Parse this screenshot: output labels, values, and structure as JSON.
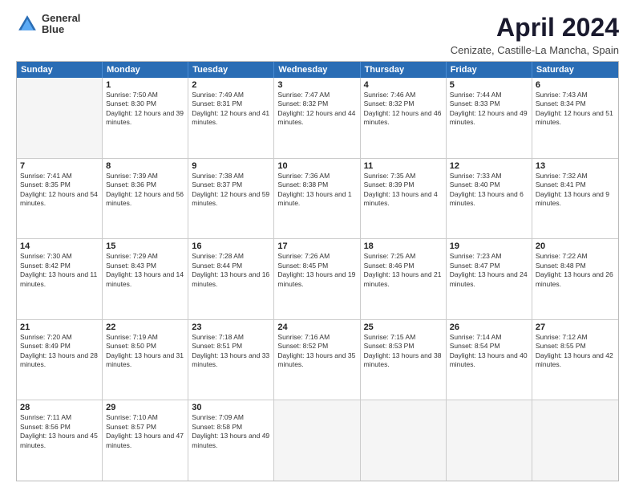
{
  "header": {
    "logo_line1": "General",
    "logo_line2": "Blue",
    "title": "April 2024",
    "subtitle": "Cenizate, Castille-La Mancha, Spain"
  },
  "weekdays": [
    "Sunday",
    "Monday",
    "Tuesday",
    "Wednesday",
    "Thursday",
    "Friday",
    "Saturday"
  ],
  "weeks": [
    [
      {
        "day": "",
        "sunrise": "",
        "sunset": "",
        "daylight": ""
      },
      {
        "day": "1",
        "sunrise": "Sunrise: 7:50 AM",
        "sunset": "Sunset: 8:30 PM",
        "daylight": "Daylight: 12 hours and 39 minutes."
      },
      {
        "day": "2",
        "sunrise": "Sunrise: 7:49 AM",
        "sunset": "Sunset: 8:31 PM",
        "daylight": "Daylight: 12 hours and 41 minutes."
      },
      {
        "day": "3",
        "sunrise": "Sunrise: 7:47 AM",
        "sunset": "Sunset: 8:32 PM",
        "daylight": "Daylight: 12 hours and 44 minutes."
      },
      {
        "day": "4",
        "sunrise": "Sunrise: 7:46 AM",
        "sunset": "Sunset: 8:32 PM",
        "daylight": "Daylight: 12 hours and 46 minutes."
      },
      {
        "day": "5",
        "sunrise": "Sunrise: 7:44 AM",
        "sunset": "Sunset: 8:33 PM",
        "daylight": "Daylight: 12 hours and 49 minutes."
      },
      {
        "day": "6",
        "sunrise": "Sunrise: 7:43 AM",
        "sunset": "Sunset: 8:34 PM",
        "daylight": "Daylight: 12 hours and 51 minutes."
      }
    ],
    [
      {
        "day": "7",
        "sunrise": "Sunrise: 7:41 AM",
        "sunset": "Sunset: 8:35 PM",
        "daylight": "Daylight: 12 hours and 54 minutes."
      },
      {
        "day": "8",
        "sunrise": "Sunrise: 7:39 AM",
        "sunset": "Sunset: 8:36 PM",
        "daylight": "Daylight: 12 hours and 56 minutes."
      },
      {
        "day": "9",
        "sunrise": "Sunrise: 7:38 AM",
        "sunset": "Sunset: 8:37 PM",
        "daylight": "Daylight: 12 hours and 59 minutes."
      },
      {
        "day": "10",
        "sunrise": "Sunrise: 7:36 AM",
        "sunset": "Sunset: 8:38 PM",
        "daylight": "Daylight: 13 hours and 1 minute."
      },
      {
        "day": "11",
        "sunrise": "Sunrise: 7:35 AM",
        "sunset": "Sunset: 8:39 PM",
        "daylight": "Daylight: 13 hours and 4 minutes."
      },
      {
        "day": "12",
        "sunrise": "Sunrise: 7:33 AM",
        "sunset": "Sunset: 8:40 PM",
        "daylight": "Daylight: 13 hours and 6 minutes."
      },
      {
        "day": "13",
        "sunrise": "Sunrise: 7:32 AM",
        "sunset": "Sunset: 8:41 PM",
        "daylight": "Daylight: 13 hours and 9 minutes."
      }
    ],
    [
      {
        "day": "14",
        "sunrise": "Sunrise: 7:30 AM",
        "sunset": "Sunset: 8:42 PM",
        "daylight": "Daylight: 13 hours and 11 minutes."
      },
      {
        "day": "15",
        "sunrise": "Sunrise: 7:29 AM",
        "sunset": "Sunset: 8:43 PM",
        "daylight": "Daylight: 13 hours and 14 minutes."
      },
      {
        "day": "16",
        "sunrise": "Sunrise: 7:28 AM",
        "sunset": "Sunset: 8:44 PM",
        "daylight": "Daylight: 13 hours and 16 minutes."
      },
      {
        "day": "17",
        "sunrise": "Sunrise: 7:26 AM",
        "sunset": "Sunset: 8:45 PM",
        "daylight": "Daylight: 13 hours and 19 minutes."
      },
      {
        "day": "18",
        "sunrise": "Sunrise: 7:25 AM",
        "sunset": "Sunset: 8:46 PM",
        "daylight": "Daylight: 13 hours and 21 minutes."
      },
      {
        "day": "19",
        "sunrise": "Sunrise: 7:23 AM",
        "sunset": "Sunset: 8:47 PM",
        "daylight": "Daylight: 13 hours and 24 minutes."
      },
      {
        "day": "20",
        "sunrise": "Sunrise: 7:22 AM",
        "sunset": "Sunset: 8:48 PM",
        "daylight": "Daylight: 13 hours and 26 minutes."
      }
    ],
    [
      {
        "day": "21",
        "sunrise": "Sunrise: 7:20 AM",
        "sunset": "Sunset: 8:49 PM",
        "daylight": "Daylight: 13 hours and 28 minutes."
      },
      {
        "day": "22",
        "sunrise": "Sunrise: 7:19 AM",
        "sunset": "Sunset: 8:50 PM",
        "daylight": "Daylight: 13 hours and 31 minutes."
      },
      {
        "day": "23",
        "sunrise": "Sunrise: 7:18 AM",
        "sunset": "Sunset: 8:51 PM",
        "daylight": "Daylight: 13 hours and 33 minutes."
      },
      {
        "day": "24",
        "sunrise": "Sunrise: 7:16 AM",
        "sunset": "Sunset: 8:52 PM",
        "daylight": "Daylight: 13 hours and 35 minutes."
      },
      {
        "day": "25",
        "sunrise": "Sunrise: 7:15 AM",
        "sunset": "Sunset: 8:53 PM",
        "daylight": "Daylight: 13 hours and 38 minutes."
      },
      {
        "day": "26",
        "sunrise": "Sunrise: 7:14 AM",
        "sunset": "Sunset: 8:54 PM",
        "daylight": "Daylight: 13 hours and 40 minutes."
      },
      {
        "day": "27",
        "sunrise": "Sunrise: 7:12 AM",
        "sunset": "Sunset: 8:55 PM",
        "daylight": "Daylight: 13 hours and 42 minutes."
      }
    ],
    [
      {
        "day": "28",
        "sunrise": "Sunrise: 7:11 AM",
        "sunset": "Sunset: 8:56 PM",
        "daylight": "Daylight: 13 hours and 45 minutes."
      },
      {
        "day": "29",
        "sunrise": "Sunrise: 7:10 AM",
        "sunset": "Sunset: 8:57 PM",
        "daylight": "Daylight: 13 hours and 47 minutes."
      },
      {
        "day": "30",
        "sunrise": "Sunrise: 7:09 AM",
        "sunset": "Sunset: 8:58 PM",
        "daylight": "Daylight: 13 hours and 49 minutes."
      },
      {
        "day": "",
        "sunrise": "",
        "sunset": "",
        "daylight": ""
      },
      {
        "day": "",
        "sunrise": "",
        "sunset": "",
        "daylight": ""
      },
      {
        "day": "",
        "sunrise": "",
        "sunset": "",
        "daylight": ""
      },
      {
        "day": "",
        "sunrise": "",
        "sunset": "",
        "daylight": ""
      }
    ]
  ]
}
